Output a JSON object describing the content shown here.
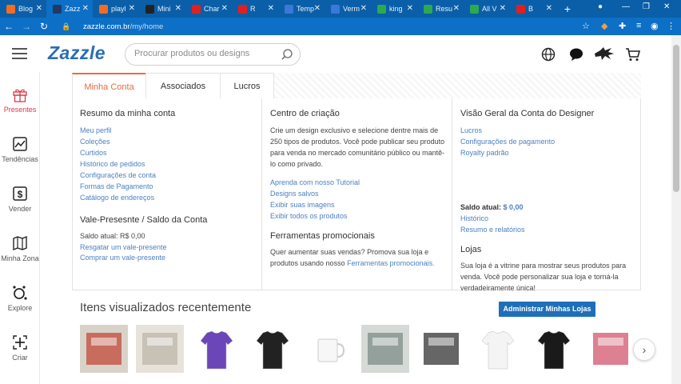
{
  "browser": {
    "tabs": [
      {
        "label": "Blog",
        "color": "#f26c23",
        "active": false
      },
      {
        "label": "Zazz",
        "color": "#1c3b66",
        "active": true
      },
      {
        "label": "playl",
        "color": "#f26c23",
        "active": false
      },
      {
        "label": "Mini",
        "color": "#222222",
        "active": false
      },
      {
        "label": "Char",
        "color": "#e02020",
        "active": false
      },
      {
        "label": "R",
        "color": "#e02020",
        "active": false
      },
      {
        "label": "Temp",
        "color": "#3b78d8",
        "active": false
      },
      {
        "label": "Verm",
        "color": "#3b78d8",
        "active": false
      },
      {
        "label": "king",
        "color": "#2ea94f",
        "active": false
      },
      {
        "label": "Resu",
        "color": "#2ea94f",
        "active": false
      },
      {
        "label": "All V",
        "color": "#2ea94f",
        "active": false
      },
      {
        "label": "B",
        "color": "#e02020",
        "active": false
      }
    ],
    "new_tab": "+",
    "url_host": "zazzle.com.br",
    "url_path": "/my/home"
  },
  "header": {
    "logo": "Zazzle",
    "search_placeholder": "Procurar produtos ou designs"
  },
  "sidebar": {
    "items": [
      {
        "label": "Presentes",
        "icon": "gift-icon"
      },
      {
        "label": "Tendências",
        "icon": "trend-chart-icon"
      },
      {
        "label": "Vender",
        "icon": "dollar-icon"
      },
      {
        "label": "Minha Zona",
        "icon": "map-icon"
      },
      {
        "label": "Explore",
        "icon": "explore-icon"
      },
      {
        "label": "Criar",
        "icon": "create-icon"
      }
    ]
  },
  "tabs": [
    "Minha Conta",
    "Associados",
    "Lucros"
  ],
  "col1": {
    "title": "Resumo da minha conta",
    "links": [
      "Meu perfil",
      "Coleções",
      "Curtidos",
      "Histórico de pedidos",
      "Configurações de conta",
      "Formas de Pagamento",
      "Catálogo de endereços"
    ],
    "title2": "Vale-Presesnte / Saldo da Conta",
    "balance": "Saldo atual: R$ 0,00",
    "links2": [
      "Resgatar um vale-presente",
      "Comprar um vale-presente"
    ]
  },
  "col2": {
    "title": "Centro de criação",
    "desc": [
      "Crie um design exclusivo e selecione dentre mais de",
      "250 tipos de produtos. Você pode publicar seu produto",
      "para venda no mercado comunitário público ou mantê-",
      "lo como privado."
    ],
    "links": [
      "Aprenda com nosso Tutorial",
      "Designs salvos",
      "Exibir suas imagens",
      "Exibir todos os produtos"
    ],
    "title2": "Ferramentas promocionais",
    "promo_line1": "Quer aumentar suas vendas? Promova sua loja e",
    "promo_line2": "produtos usando nosso ",
    "promo_link": "Ferramentas promocionais."
  },
  "col3": {
    "title": "Visão Geral da Conta do Designer",
    "links": [
      "Lucros",
      "Configurações de pagamento",
      "Royalty padrão"
    ],
    "balance_label": "Saldo atual:",
    "balance_value": "$ 0,00",
    "links2": [
      "Histórico",
      "Resumo e relatórios"
    ],
    "title2": "Lojas",
    "stores_desc": [
      "Sua loja é a vitrine para mostrar seus produtos para",
      "venda. Você pode personalizar sua loja e torná-la",
      "verdadeiramente única!"
    ],
    "button": "Administrar Minhas Lojas"
  },
  "recent": {
    "title": "Itens visualizados recentemente",
    "items": [
      "business-cards",
      "flyer",
      "tshirt-purple",
      "tshirt-black",
      "mug",
      "cards-stack",
      "poster-band",
      "tshirt-white",
      "tshirt-black-print",
      "banner"
    ]
  },
  "colors": {
    "brand": "#2a6db5",
    "link": "#4c7fc2",
    "active_tab": "#e76b44",
    "button": "#1e6fb8"
  }
}
